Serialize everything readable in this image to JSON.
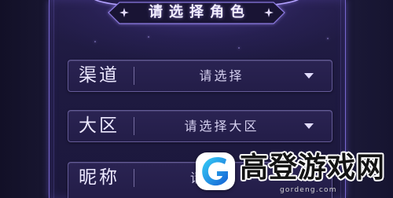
{
  "title": "请选择角色",
  "form": {
    "rows": [
      {
        "label": "渠道",
        "value": "请选择"
      },
      {
        "label": "大区",
        "value": "请选择大区"
      },
      {
        "label": "昵称",
        "value": "请"
      }
    ]
  },
  "watermark": {
    "name": "高登游戏网",
    "domain": "gordeng.com"
  },
  "icons": {
    "dropdown": "caret-down-icon",
    "title_ornament": "sparkle-star-icon",
    "watermark_logo": "gordeng-logo-icon"
  },
  "colors": {
    "page_background": "#1a1734",
    "panel_border": "#7868d0",
    "label_text": "#ece8ff",
    "value_text": "#d6d1f0",
    "title_text": "#f3efff",
    "watermark_text": "#141414"
  }
}
